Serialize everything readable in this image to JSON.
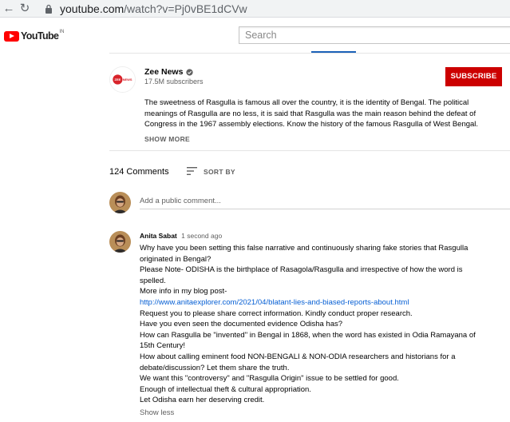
{
  "browser": {
    "url_host": "youtube.com",
    "url_path": "/watch?v=Pj0vBE1dCVw"
  },
  "header": {
    "logo_text": "YouTube",
    "logo_country": "IN",
    "search_placeholder": "Search"
  },
  "channel": {
    "name": "Zee News",
    "subscribers": "17.5M subscribers",
    "subscribe_label": "SUBSCRIBE",
    "avatar_text": "ZEENEWS"
  },
  "description": {
    "text": "The sweetness of Rasgulla is famous all over the country, it is the identity of Bengal. The political meanings of Rasgulla are no less, it is said that Rasgulla was the main reason behind the defeat of Congress in the 1967 assembly elections. Know the history of the famous Rasgulla of West Bengal.",
    "show_more": "SHOW MORE"
  },
  "comments": {
    "count_label": "124 Comments",
    "sort_label": "SORT BY",
    "add_placeholder": "Add a public comment...",
    "items": [
      {
        "author": "Anita Sabat",
        "time": "1 second ago",
        "lines": [
          "Why have you been setting this false narrative and continuously sharing fake stories that Rasgulla",
          "originated in Bengal?",
          "Please Note- ODISHA is the birthplace of Rasagola/Rasgulla and irrespective of how the word is",
          "spelled.",
          "More info in my blog post-"
        ],
        "link": "http://www.anitaexplorer.com/2021/04/blatant-lies-and-biased-reports-about.html",
        "lines_after": [
          "Request you to please share correct information. Kindly conduct proper research.",
          "Have you even seen the documented evidence Odisha has?",
          "How can Rasgulla be \"invented\" in Bengal in 1868, when the word has existed in Odia Ramayana of",
          "15th Century!",
          "How about calling eminent food NON-BENGALI & NON-ODIA researchers and historians for a",
          "debate/discussion? Let them share the truth.",
          "We want this \"controversy\" and \"Rasgulla Origin\" issue to be settled for good.",
          "Enough of intellectual theft & cultural appropriation.",
          "Let Odisha earn her deserving credit."
        ],
        "show_less": "Show less"
      }
    ]
  },
  "colors": {
    "subscribe": "#cc0000",
    "link": "#065fd4",
    "brand_red": "#ff0000"
  }
}
